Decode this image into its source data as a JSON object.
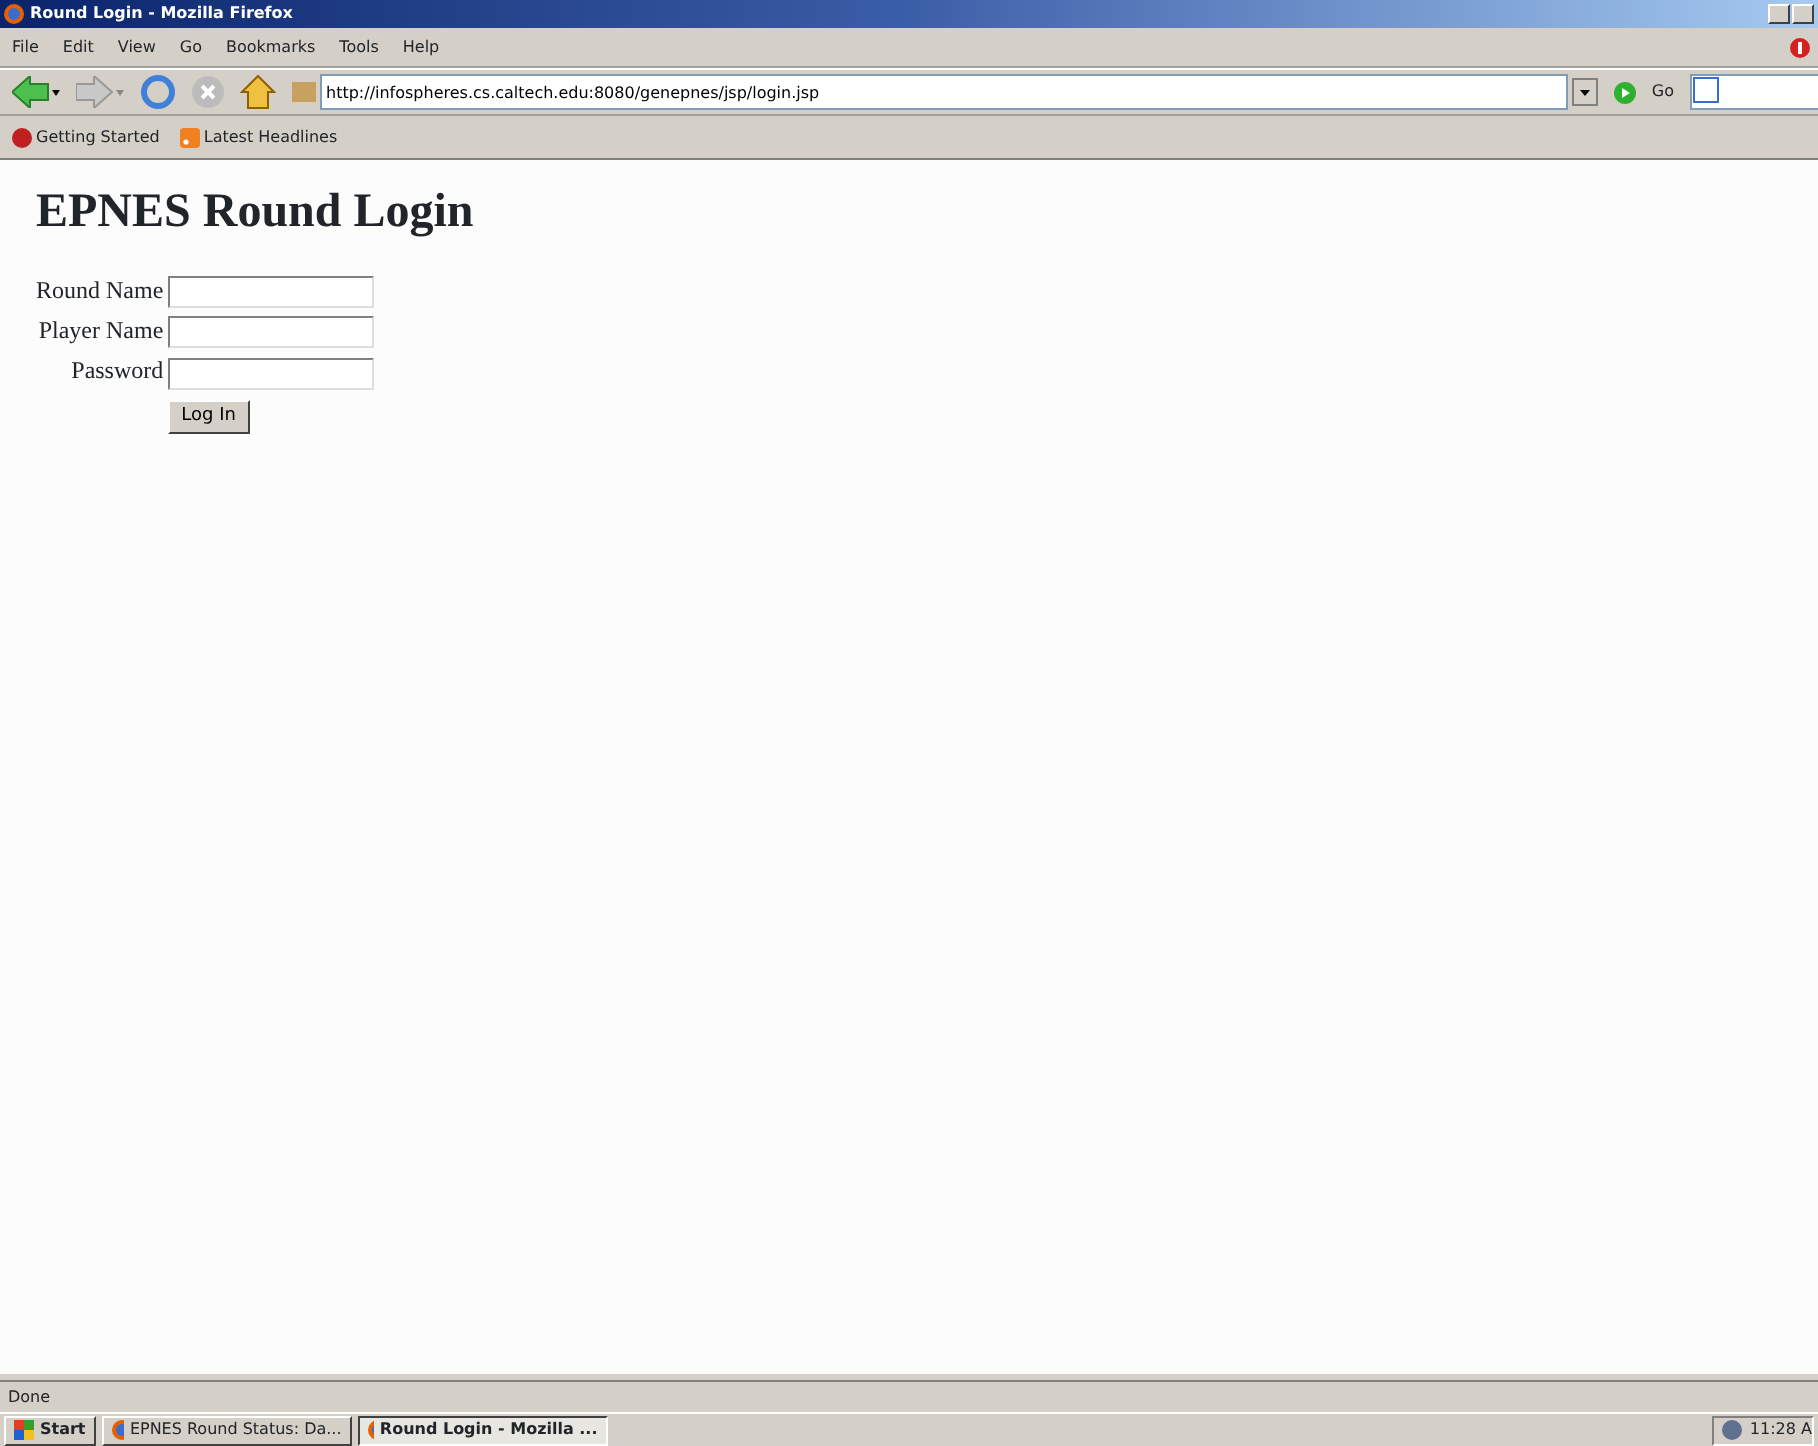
{
  "window": {
    "title": "Round Login - Mozilla Firefox"
  },
  "menu": [
    "File",
    "Edit",
    "View",
    "Go",
    "Bookmarks",
    "Tools",
    "Help"
  ],
  "address_bar": {
    "value": "http://infospheres.cs.caltech.edu:8080/genepnes/jsp/login.jsp",
    "go_label": "Go"
  },
  "bookmarks": [
    {
      "label": "Getting Started",
      "kind": "page"
    },
    {
      "label": "Latest Headlines",
      "kind": "feed"
    }
  ],
  "page": {
    "heading": "EPNES Round Login",
    "fields": [
      {
        "label": "Round Name"
      },
      {
        "label": "Player Name"
      },
      {
        "label": "Password"
      }
    ],
    "submit": "Log In"
  },
  "status_bar": "Done",
  "taskbar": {
    "start": "Start",
    "tasks": [
      {
        "label": "EPNES Round Status: Da...",
        "selected": false
      },
      {
        "label": "Round Login - Mozilla ...",
        "selected": true
      }
    ],
    "clock": "11:28 A"
  }
}
